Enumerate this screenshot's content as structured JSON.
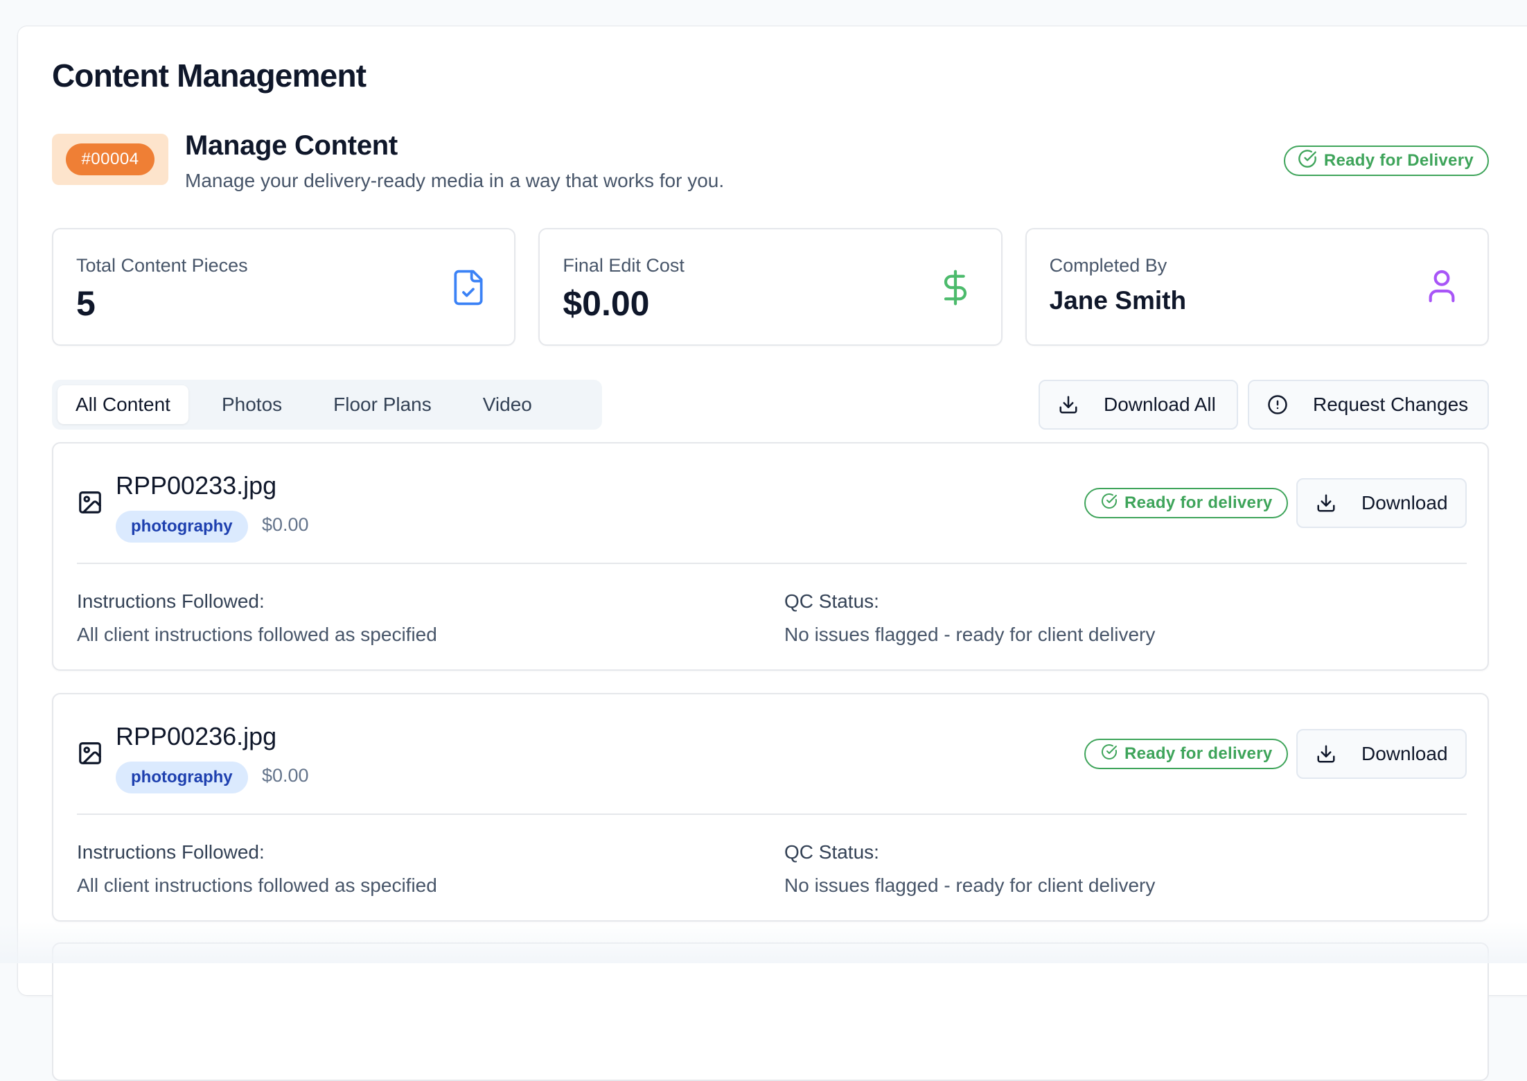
{
  "page": {
    "title": "Content Management"
  },
  "header": {
    "order_id": "#00004",
    "title": "Manage Content",
    "subtitle": "Manage your delivery-ready media in a way that works for you.",
    "status": "Ready for Delivery"
  },
  "stats": {
    "total": {
      "label": "Total Content Pieces",
      "value": "5",
      "icon": "file-check-icon"
    },
    "cost": {
      "label": "Final Edit Cost",
      "value": "$0.00",
      "icon": "dollar-icon"
    },
    "completed": {
      "label": "Completed By",
      "value": "Jane Smith",
      "icon": "user-icon"
    }
  },
  "tabs": [
    {
      "label": "All Content",
      "active": true
    },
    {
      "label": "Photos",
      "active": false
    },
    {
      "label": "Floor Plans",
      "active": false
    },
    {
      "label": "Video",
      "active": false
    }
  ],
  "actions": {
    "download_all": "Download All",
    "request_changes": "Request Changes"
  },
  "items": [
    {
      "file_name": "RPP00233.jpg",
      "tag": "photography",
      "price": "$0.00",
      "status": "Ready for delivery",
      "download_label": "Download",
      "instructions_label": "Instructions Followed:",
      "instructions_value": "All client instructions followed as specified",
      "qc_label": "QC Status:",
      "qc_value": "No issues flagged - ready for client delivery"
    },
    {
      "file_name": "RPP00236.jpg",
      "tag": "photography",
      "price": "$0.00",
      "status": "Ready for delivery",
      "download_label": "Download",
      "instructions_label": "Instructions Followed:",
      "instructions_value": "All client instructions followed as specified",
      "qc_label": "QC Status:",
      "qc_value": "No issues flagged - ready for client delivery"
    }
  ],
  "colors": {
    "accent_green": "#3ea45a",
    "chip_orange": "#ef7f35",
    "chip_orange_bg": "#fde4cc",
    "tag_blue_bg": "#dbeafe",
    "tag_blue_text": "#1e40af",
    "icon_blue": "#3b82f6",
    "icon_green": "#4cbb6c",
    "icon_purple": "#a855f7"
  }
}
